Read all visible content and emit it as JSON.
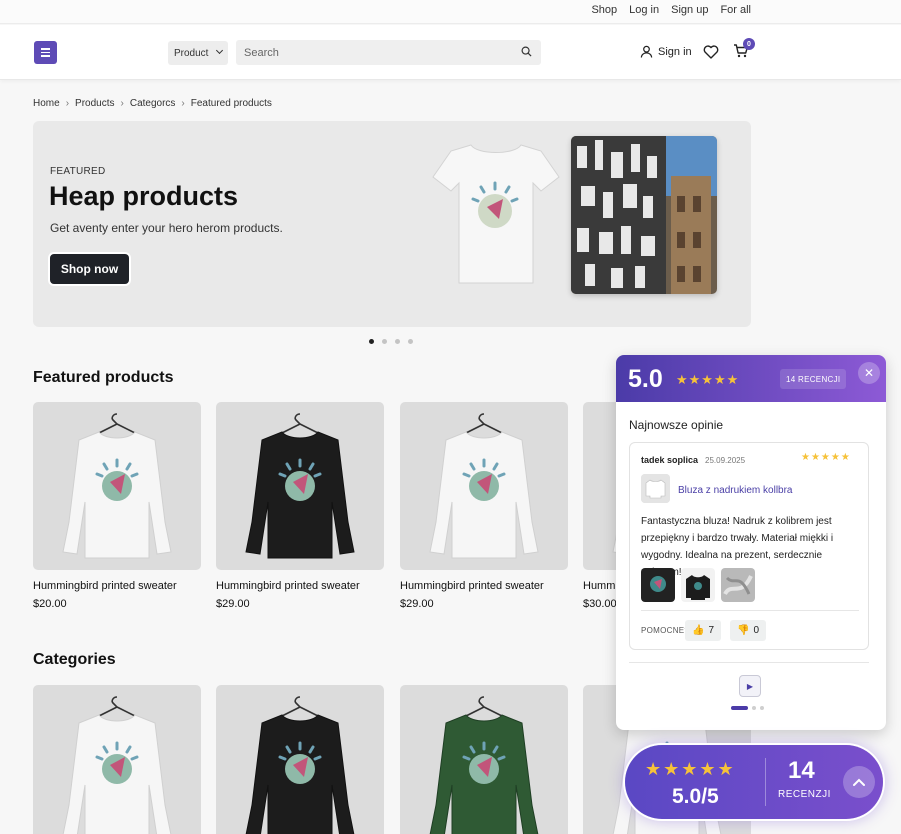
{
  "topbar": {
    "links": [
      "Shop",
      "Log in",
      "Sign up",
      "For all"
    ]
  },
  "header": {
    "category_select": "Product",
    "search_placeholder": "Search",
    "signin_label": "Sign in",
    "cart_count": "0"
  },
  "breadcrumb": [
    "Home",
    "Products",
    "Categorcs",
    "Featured products"
  ],
  "hero": {
    "kicker": "FEATURED",
    "title": "Heap products",
    "subtitle": "Get aventy enter your hero herom products.",
    "cta_label": "Shop now",
    "slide_count": 4,
    "active_slide": 1
  },
  "featured": {
    "title": "Featured products",
    "products": [
      {
        "name": "Hummingbird printed sweater",
        "price": "$20.00",
        "color": "white"
      },
      {
        "name": "Hummingbird printed sweater",
        "price": "$29.00",
        "color": "black"
      },
      {
        "name": "Hummingbird printed sweater",
        "price": "$29.00",
        "color": "white"
      },
      {
        "name": "Hummingbird printed sweater",
        "price": "$30.00",
        "color": "white"
      }
    ]
  },
  "categories": {
    "title": "Categories",
    "items": [
      {
        "color": "white"
      },
      {
        "color": "black"
      },
      {
        "color": "green"
      },
      {
        "color": "white"
      }
    ]
  },
  "reviews_panel": {
    "score": "5.0",
    "rating": 5,
    "count_label": "14 RECENCJI",
    "subtitle": "Najnowsze opinie",
    "review": {
      "author": "tadek soplica",
      "date": "25.09.2025",
      "rating": 5,
      "product": "Bluza z nadrukiem kollbra",
      "text": "Fantastyczna bluza! Nadruk z kolibrem jest przepiękny i bardzo trwały. Materiał miękki i wygodny. Idealna na prezent, serdecznie polecam!",
      "helpful_label": "POMOCNE?",
      "helpful_up": "7",
      "helpful_down": "0"
    },
    "pager_count": 3,
    "pager_active": 1
  },
  "badge": {
    "rating": 5,
    "score": "5.0/5",
    "count": "14",
    "label": "RECENZJI"
  },
  "colors": {
    "accent": "#5e4bb6",
    "star": "#f6c23a",
    "cta": "#1f2228"
  }
}
